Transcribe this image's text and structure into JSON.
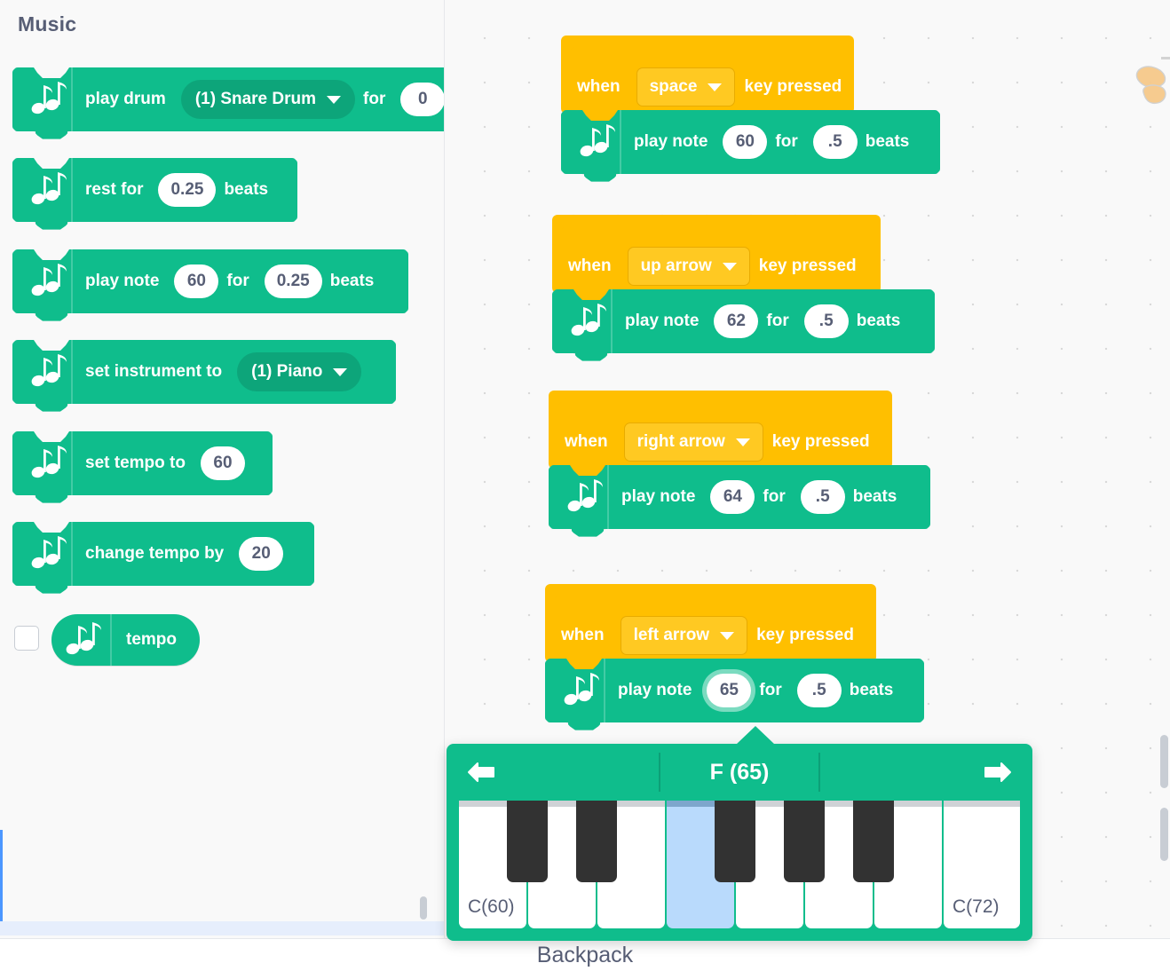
{
  "palette": {
    "category": "Music",
    "blocks": [
      {
        "id": "play-drum",
        "type": "stack",
        "icon": "music-notes-icon",
        "parts": [
          {
            "kind": "label",
            "text": "play drum"
          },
          {
            "kind": "dropdown",
            "text": "(1) Snare Drum"
          },
          {
            "kind": "label",
            "text": "for"
          },
          {
            "kind": "input",
            "text": "0"
          }
        ]
      },
      {
        "id": "rest-for",
        "type": "stack",
        "icon": "music-notes-icon",
        "parts": [
          {
            "kind": "label",
            "text": "rest for"
          },
          {
            "kind": "input",
            "text": "0.25"
          },
          {
            "kind": "label",
            "text": "beats"
          }
        ]
      },
      {
        "id": "play-note",
        "type": "stack",
        "icon": "music-notes-icon",
        "parts": [
          {
            "kind": "label",
            "text": "play note"
          },
          {
            "kind": "input",
            "text": "60"
          },
          {
            "kind": "label",
            "text": "for"
          },
          {
            "kind": "input",
            "text": "0.25"
          },
          {
            "kind": "label",
            "text": "beats"
          }
        ]
      },
      {
        "id": "set-instrument",
        "type": "stack",
        "icon": "music-notes-icon",
        "parts": [
          {
            "kind": "label",
            "text": "set instrument to"
          },
          {
            "kind": "dropdown",
            "text": "(1) Piano"
          }
        ]
      },
      {
        "id": "set-tempo",
        "type": "stack",
        "icon": "music-notes-icon",
        "parts": [
          {
            "kind": "label",
            "text": "set tempo to"
          },
          {
            "kind": "input",
            "text": "60"
          }
        ]
      },
      {
        "id": "change-tempo",
        "type": "stack",
        "icon": "music-notes-icon",
        "parts": [
          {
            "kind": "label",
            "text": "change tempo by"
          },
          {
            "kind": "input",
            "text": "20"
          }
        ]
      }
    ],
    "reporter": {
      "id": "tempo",
      "label": "tempo",
      "icon": "music-notes-icon",
      "checked": false
    }
  },
  "workspace": {
    "scripts": [
      {
        "id": "script-space",
        "hat": {
          "prefix": "when",
          "key": "space",
          "suffix": "key pressed"
        },
        "body": {
          "label1": "play note",
          "note": "60",
          "label2": "for",
          "beats": ".5",
          "label3": "beats",
          "active": false
        }
      },
      {
        "id": "script-up-arrow",
        "hat": {
          "prefix": "when",
          "key": "up arrow",
          "suffix": "key pressed"
        },
        "body": {
          "label1": "play note",
          "note": "62",
          "label2": "for",
          "beats": ".5",
          "label3": "beats",
          "active": false
        }
      },
      {
        "id": "script-right-arrow",
        "hat": {
          "prefix": "when",
          "key": "right arrow",
          "suffix": "key pressed"
        },
        "body": {
          "label1": "play note",
          "note": "64",
          "label2": "for",
          "beats": ".5",
          "label3": "beats",
          "active": false
        }
      },
      {
        "id": "script-left-arrow",
        "hat": {
          "prefix": "when",
          "key": "left arrow",
          "suffix": "key pressed"
        },
        "body": {
          "label1": "play note",
          "note": "65",
          "label2": "for",
          "beats": ".5",
          "label3": "beats",
          "active": true
        }
      }
    ]
  },
  "piano": {
    "title": "F (65)",
    "prev_icon": "arrow-left-icon",
    "next_icon": "arrow-right-icon",
    "white_keys": [
      {
        "note": "C",
        "midi": 60,
        "label": "C(60)",
        "selected": false
      },
      {
        "note": "D",
        "midi": 62,
        "label": "",
        "selected": false
      },
      {
        "note": "E",
        "midi": 64,
        "label": "",
        "selected": false
      },
      {
        "note": "F",
        "midi": 65,
        "label": "",
        "selected": true
      },
      {
        "note": "G",
        "midi": 67,
        "label": "",
        "selected": false
      },
      {
        "note": "A",
        "midi": 69,
        "label": "",
        "selected": false
      },
      {
        "note": "B",
        "midi": 71,
        "label": "",
        "selected": false
      },
      {
        "note": "C",
        "midi": 72,
        "label": "C(72)",
        "selected": false
      }
    ],
    "black_keys": [
      {
        "note": "C#",
        "midi": 61,
        "after_white": 0
      },
      {
        "note": "D#",
        "midi": 63,
        "after_white": 1
      },
      {
        "note": "F#",
        "midi": 66,
        "after_white": 3
      },
      {
        "note": "G#",
        "midi": 68,
        "after_white": 4
      },
      {
        "note": "A#",
        "midi": 70,
        "after_white": 5
      }
    ]
  },
  "bottom": {
    "backpack_label": "Backpack"
  },
  "colors": {
    "music_green": "#0fbd8c",
    "music_green_dark": "#0da57a",
    "events_yellow": "#ffbf00",
    "events_yellow_light": "#ffc922",
    "text_gray": "#575e75",
    "key_selected_blue": "#b9dafc",
    "black_key": "#323232",
    "workspace_bg": "#f9f9f9"
  }
}
